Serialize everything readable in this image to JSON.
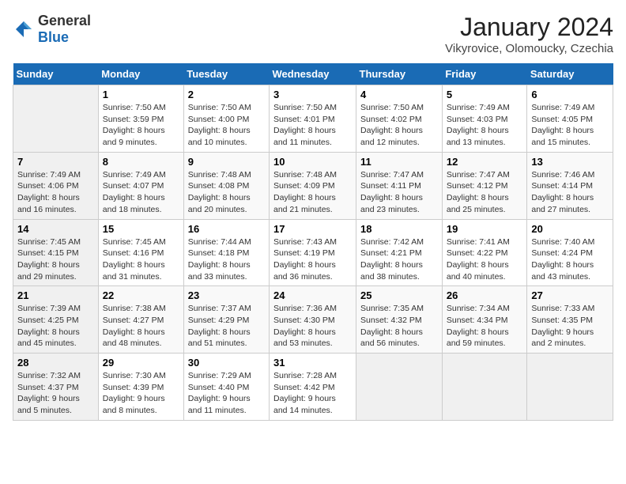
{
  "logo": {
    "text_general": "General",
    "text_blue": "Blue"
  },
  "header": {
    "month_title": "January 2024",
    "location": "Vikyrovice, Olomoucky, Czechia"
  },
  "days_of_week": [
    "Sunday",
    "Monday",
    "Tuesday",
    "Wednesday",
    "Thursday",
    "Friday",
    "Saturday"
  ],
  "weeks": [
    [
      {
        "day": "",
        "sunrise": "",
        "sunset": "",
        "daylight": ""
      },
      {
        "day": "1",
        "sunrise": "Sunrise: 7:50 AM",
        "sunset": "Sunset: 3:59 PM",
        "daylight": "Daylight: 8 hours and 9 minutes."
      },
      {
        "day": "2",
        "sunrise": "Sunrise: 7:50 AM",
        "sunset": "Sunset: 4:00 PM",
        "daylight": "Daylight: 8 hours and 10 minutes."
      },
      {
        "day": "3",
        "sunrise": "Sunrise: 7:50 AM",
        "sunset": "Sunset: 4:01 PM",
        "daylight": "Daylight: 8 hours and 11 minutes."
      },
      {
        "day": "4",
        "sunrise": "Sunrise: 7:50 AM",
        "sunset": "Sunset: 4:02 PM",
        "daylight": "Daylight: 8 hours and 12 minutes."
      },
      {
        "day": "5",
        "sunrise": "Sunrise: 7:49 AM",
        "sunset": "Sunset: 4:03 PM",
        "daylight": "Daylight: 8 hours and 13 minutes."
      },
      {
        "day": "6",
        "sunrise": "Sunrise: 7:49 AM",
        "sunset": "Sunset: 4:05 PM",
        "daylight": "Daylight: 8 hours and 15 minutes."
      }
    ],
    [
      {
        "day": "7",
        "sunrise": "Sunrise: 7:49 AM",
        "sunset": "Sunset: 4:06 PM",
        "daylight": "Daylight: 8 hours and 16 minutes."
      },
      {
        "day": "8",
        "sunrise": "Sunrise: 7:49 AM",
        "sunset": "Sunset: 4:07 PM",
        "daylight": "Daylight: 8 hours and 18 minutes."
      },
      {
        "day": "9",
        "sunrise": "Sunrise: 7:48 AM",
        "sunset": "Sunset: 4:08 PM",
        "daylight": "Daylight: 8 hours and 20 minutes."
      },
      {
        "day": "10",
        "sunrise": "Sunrise: 7:48 AM",
        "sunset": "Sunset: 4:09 PM",
        "daylight": "Daylight: 8 hours and 21 minutes."
      },
      {
        "day": "11",
        "sunrise": "Sunrise: 7:47 AM",
        "sunset": "Sunset: 4:11 PM",
        "daylight": "Daylight: 8 hours and 23 minutes."
      },
      {
        "day": "12",
        "sunrise": "Sunrise: 7:47 AM",
        "sunset": "Sunset: 4:12 PM",
        "daylight": "Daylight: 8 hours and 25 minutes."
      },
      {
        "day": "13",
        "sunrise": "Sunrise: 7:46 AM",
        "sunset": "Sunset: 4:14 PM",
        "daylight": "Daylight: 8 hours and 27 minutes."
      }
    ],
    [
      {
        "day": "14",
        "sunrise": "Sunrise: 7:45 AM",
        "sunset": "Sunset: 4:15 PM",
        "daylight": "Daylight: 8 hours and 29 minutes."
      },
      {
        "day": "15",
        "sunrise": "Sunrise: 7:45 AM",
        "sunset": "Sunset: 4:16 PM",
        "daylight": "Daylight: 8 hours and 31 minutes."
      },
      {
        "day": "16",
        "sunrise": "Sunrise: 7:44 AM",
        "sunset": "Sunset: 4:18 PM",
        "daylight": "Daylight: 8 hours and 33 minutes."
      },
      {
        "day": "17",
        "sunrise": "Sunrise: 7:43 AM",
        "sunset": "Sunset: 4:19 PM",
        "daylight": "Daylight: 8 hours and 36 minutes."
      },
      {
        "day": "18",
        "sunrise": "Sunrise: 7:42 AM",
        "sunset": "Sunset: 4:21 PM",
        "daylight": "Daylight: 8 hours and 38 minutes."
      },
      {
        "day": "19",
        "sunrise": "Sunrise: 7:41 AM",
        "sunset": "Sunset: 4:22 PM",
        "daylight": "Daylight: 8 hours and 40 minutes."
      },
      {
        "day": "20",
        "sunrise": "Sunrise: 7:40 AM",
        "sunset": "Sunset: 4:24 PM",
        "daylight": "Daylight: 8 hours and 43 minutes."
      }
    ],
    [
      {
        "day": "21",
        "sunrise": "Sunrise: 7:39 AM",
        "sunset": "Sunset: 4:25 PM",
        "daylight": "Daylight: 8 hours and 45 minutes."
      },
      {
        "day": "22",
        "sunrise": "Sunrise: 7:38 AM",
        "sunset": "Sunset: 4:27 PM",
        "daylight": "Daylight: 8 hours and 48 minutes."
      },
      {
        "day": "23",
        "sunrise": "Sunrise: 7:37 AM",
        "sunset": "Sunset: 4:29 PM",
        "daylight": "Daylight: 8 hours and 51 minutes."
      },
      {
        "day": "24",
        "sunrise": "Sunrise: 7:36 AM",
        "sunset": "Sunset: 4:30 PM",
        "daylight": "Daylight: 8 hours and 53 minutes."
      },
      {
        "day": "25",
        "sunrise": "Sunrise: 7:35 AM",
        "sunset": "Sunset: 4:32 PM",
        "daylight": "Daylight: 8 hours and 56 minutes."
      },
      {
        "day": "26",
        "sunrise": "Sunrise: 7:34 AM",
        "sunset": "Sunset: 4:34 PM",
        "daylight": "Daylight: 8 hours and 59 minutes."
      },
      {
        "day": "27",
        "sunrise": "Sunrise: 7:33 AM",
        "sunset": "Sunset: 4:35 PM",
        "daylight": "Daylight: 9 hours and 2 minutes."
      }
    ],
    [
      {
        "day": "28",
        "sunrise": "Sunrise: 7:32 AM",
        "sunset": "Sunset: 4:37 PM",
        "daylight": "Daylight: 9 hours and 5 minutes."
      },
      {
        "day": "29",
        "sunrise": "Sunrise: 7:30 AM",
        "sunset": "Sunset: 4:39 PM",
        "daylight": "Daylight: 9 hours and 8 minutes."
      },
      {
        "day": "30",
        "sunrise": "Sunrise: 7:29 AM",
        "sunset": "Sunset: 4:40 PM",
        "daylight": "Daylight: 9 hours and 11 minutes."
      },
      {
        "day": "31",
        "sunrise": "Sunrise: 7:28 AM",
        "sunset": "Sunset: 4:42 PM",
        "daylight": "Daylight: 9 hours and 14 minutes."
      },
      {
        "day": "",
        "sunrise": "",
        "sunset": "",
        "daylight": ""
      },
      {
        "day": "",
        "sunrise": "",
        "sunset": "",
        "daylight": ""
      },
      {
        "day": "",
        "sunrise": "",
        "sunset": "",
        "daylight": ""
      }
    ]
  ]
}
